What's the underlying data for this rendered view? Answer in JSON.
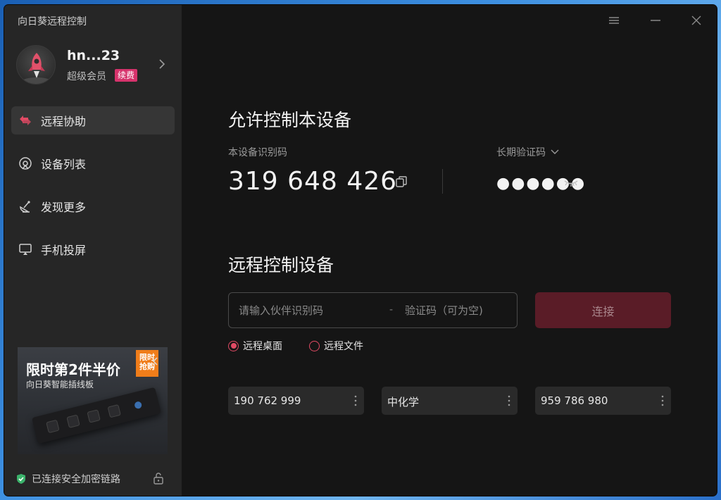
{
  "app": {
    "title": "向日葵远程控制"
  },
  "profile": {
    "username": "hn...23",
    "membership": "超级会员",
    "renew_label": "续费"
  },
  "nav": {
    "items": [
      {
        "label": "远程协助",
        "icon": "remote-assist-icon",
        "active": true
      },
      {
        "label": "设备列表",
        "icon": "device-list-icon",
        "active": false
      },
      {
        "label": "发现更多",
        "icon": "discover-icon",
        "active": false
      },
      {
        "label": "手机投屏",
        "icon": "screen-cast-icon",
        "active": false
      }
    ]
  },
  "ad": {
    "title": "限时第2件半价",
    "subtitle": "向日葵智能插线板",
    "badge": "限时抢购"
  },
  "footer": {
    "security_text": "已连接安全加密链路"
  },
  "allow": {
    "heading": "允许控制本设备",
    "device_id_label": "本设备识别码",
    "device_id": "319 648 426",
    "code_label": "长期验证码",
    "code_masked": "●●●●●●"
  },
  "control": {
    "heading": "远程控制设备",
    "partner_placeholder": "请输入伙伴识别码",
    "separator": "-",
    "code_placeholder": "验证码（可为空)",
    "connect_label": "连接",
    "mode_desktop": "远程桌面",
    "mode_file": "远程文件",
    "recent": [
      {
        "label": "190 762 999"
      },
      {
        "label": "中化学"
      },
      {
        "label": "959 786 980"
      }
    ]
  },
  "colors": {
    "accent": "#e04a64",
    "renew_badge": "#d6336c",
    "connect_bg": "#5a1c27"
  }
}
